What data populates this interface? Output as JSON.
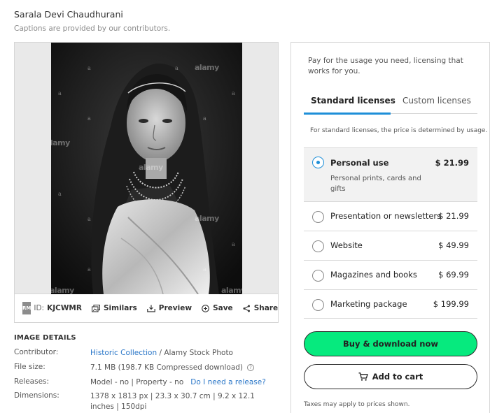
{
  "header": {
    "title": "Sarala Devi Chaudhurani",
    "subtitle": "Captions are provided by our contributors."
  },
  "image": {
    "watermark": "alamy",
    "watermark_small": "a",
    "badge": "RM",
    "id_label": "ID:",
    "id_value": "KJCWMR",
    "tools": {
      "similars": "Similars",
      "preview": "Preview",
      "save": "Save",
      "share": "Share"
    }
  },
  "details": {
    "heading": "IMAGE DETAILS",
    "contributor_label": "Contributor:",
    "contributor_link": "Historic Collection",
    "contributor_rest": " / Alamy Stock Photo",
    "filesize_label": "File size:",
    "filesize_value": "7.1 MB (198.7 KB Compressed download)",
    "releases_label": "Releases:",
    "releases_value": "Model - no | Property - no",
    "releases_link": "Do I need a release?",
    "dimensions_label": "Dimensions:",
    "dimensions_value": "1378 x 1813 px | 23.3 x 30.7 cm | 9.2 x 12.1 inches | 150dpi"
  },
  "license": {
    "pay_text": "Pay for the usage you need, licensing that works for you.",
    "tabs": {
      "standard": "Standard licenses",
      "custom": "Custom licenses"
    },
    "standard_note": "For standard licenses, the price is determined by usage.",
    "options": [
      {
        "name": "Personal use",
        "desc": "Personal prints, cards and gifts",
        "price": "$ 21.99"
      },
      {
        "name": "Presentation or newsletters",
        "price": "$ 21.99"
      },
      {
        "name": "Website",
        "price": "$ 49.99"
      },
      {
        "name": "Magazines and books",
        "price": "$ 69.99"
      },
      {
        "name": "Marketing package",
        "price": "$ 199.99"
      }
    ],
    "buy_label": "Buy & download now",
    "cart_label": "Add to cart",
    "tax_note": "Taxes may apply to prices shown."
  },
  "colors": {
    "accent": "#1e8fd8",
    "buy_button": "#06ea7e",
    "link": "#2b77c8"
  }
}
